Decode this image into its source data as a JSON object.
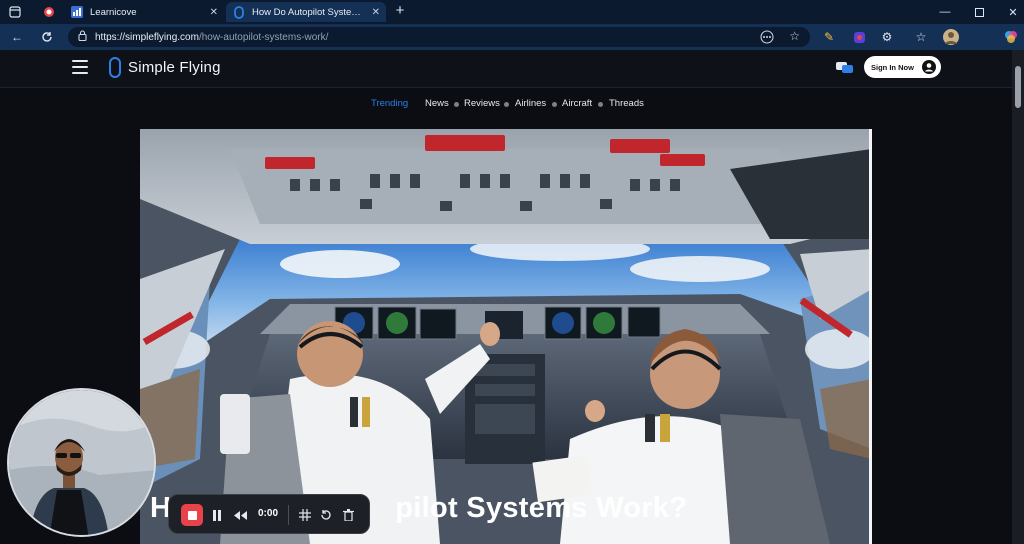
{
  "browser": {
    "tabs": [
      {
        "label": "",
        "favicon": "record-icon"
      },
      {
        "label": "Learnicove",
        "favicon": "chart-icon"
      },
      {
        "label": "How Do Autopilot Systems Work?",
        "favicon": "simpleflying-logo-icon",
        "active": true
      }
    ],
    "new_tab": "+",
    "window_controls": [
      "minimize",
      "maximize",
      "close"
    ],
    "url": {
      "host": "https://simpleflying.com",
      "path": "/how-autopilot-systems-work/"
    }
  },
  "site": {
    "brand": "Simple Flying",
    "sign_in_label": "Sign In Now",
    "nav": {
      "trending": "Trending",
      "items": [
        "News",
        "Reviews",
        "Airlines",
        "Aircraft",
        "Threads"
      ]
    },
    "hero": {
      "image_alt": "Pilots in cockpit with autopilot panel",
      "title_visible": "H",
      "title_tail": "pilot Systems Work?"
    }
  },
  "recorder": {
    "time": "0:00",
    "controls": [
      "stop",
      "pause",
      "rewind",
      "grid",
      "restart",
      "delete"
    ]
  },
  "colors": {
    "accent": "#2f7fe8",
    "tab_bg": "#143055",
    "rec_stop": "#e8424a"
  }
}
